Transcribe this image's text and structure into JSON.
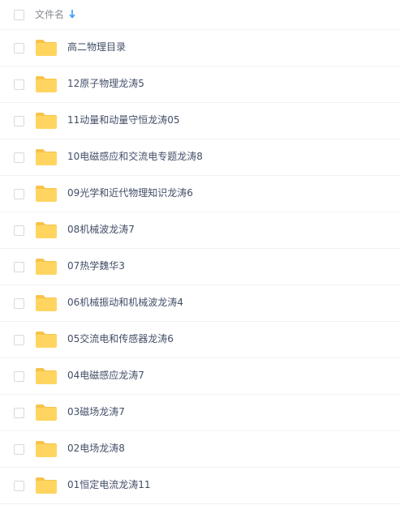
{
  "header": {
    "column_label": "文件名",
    "sort_direction": "descending"
  },
  "colors": {
    "folder": "#ffd560",
    "folder_tab": "#f7c34a",
    "sort_arrow": "#3b9bf5",
    "text": "#424e67",
    "header_text": "#888c93"
  },
  "files": [
    {
      "name": "高二物理目录",
      "icon": "folder-icon"
    },
    {
      "name": "12原子物理龙涛5",
      "icon": "folder-icon"
    },
    {
      "name": "11动量和动量守恒龙涛05",
      "icon": "folder-icon"
    },
    {
      "name": "10电磁感应和交流电专题龙涛8",
      "icon": "folder-icon"
    },
    {
      "name": "09光学和近代物理知识龙涛6",
      "icon": "folder-icon"
    },
    {
      "name": "08机械波龙涛7",
      "icon": "folder-icon"
    },
    {
      "name": "07热学魏华3",
      "icon": "folder-icon"
    },
    {
      "name": "06机械振动和机械波龙涛4",
      "icon": "folder-icon"
    },
    {
      "name": "05交流电和传感器龙涛6",
      "icon": "folder-icon"
    },
    {
      "name": "04电磁感应龙涛7",
      "icon": "folder-icon"
    },
    {
      "name": "03磁场龙涛7",
      "icon": "folder-icon"
    },
    {
      "name": "02电场龙涛8",
      "icon": "folder-icon"
    },
    {
      "name": "01恒定电流龙涛11",
      "icon": "folder-icon"
    }
  ]
}
